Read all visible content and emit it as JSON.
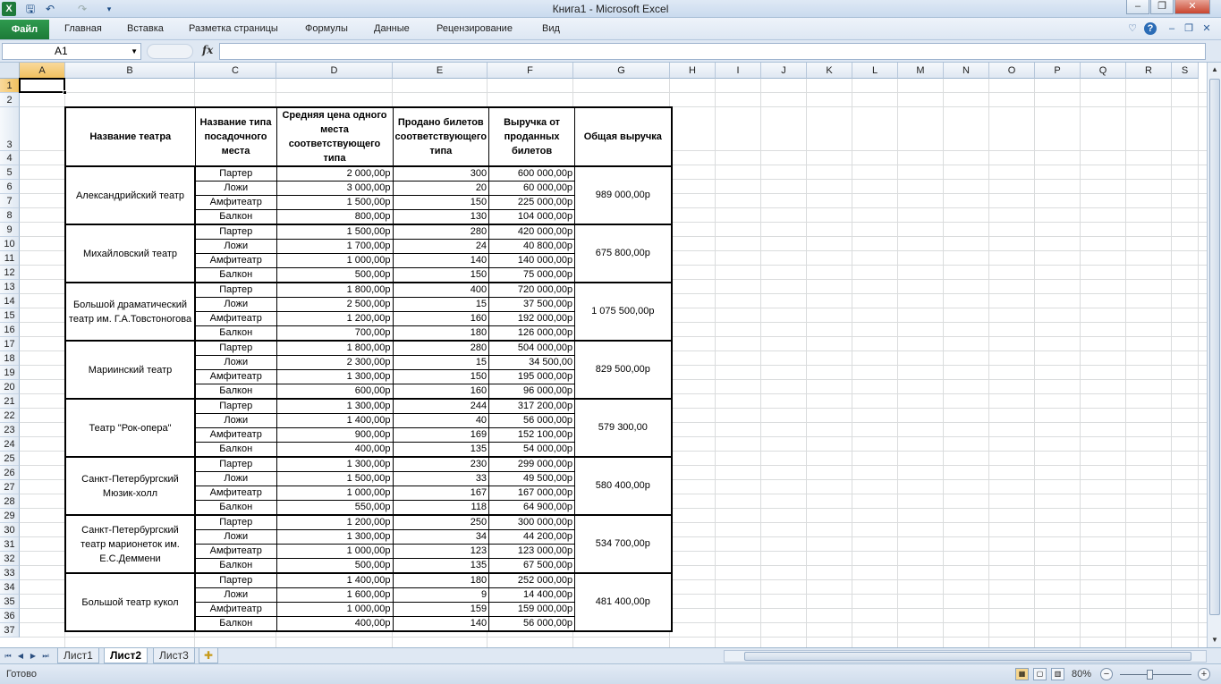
{
  "window": {
    "title": "Книга1 - Microsoft Excel",
    "app_icon": "excel-logo",
    "minimize": "–",
    "restore": "❐",
    "close": "✕"
  },
  "ribbon": {
    "file": "Файл",
    "tabs": [
      "Главная",
      "Вставка",
      "Разметка страницы",
      "Формулы",
      "Данные",
      "Рецензирование",
      "Вид"
    ]
  },
  "formula_bar": {
    "name_box": "A1",
    "fx": "fx",
    "formula": ""
  },
  "grid": {
    "columns": [
      "A",
      "B",
      "C",
      "D",
      "E",
      "F",
      "G",
      "H",
      "I",
      "J",
      "K",
      "L",
      "M",
      "N",
      "O",
      "P",
      "Q",
      "R",
      "S"
    ],
    "rows": [
      "1",
      "2",
      "3",
      "4",
      "5",
      "6",
      "7",
      "8",
      "9",
      "10",
      "11",
      "12",
      "13",
      "14",
      "15",
      "16",
      "17",
      "18",
      "19",
      "20",
      "21",
      "22",
      "23",
      "24",
      "25",
      "26",
      "27",
      "28",
      "29",
      "30",
      "31",
      "32",
      "33",
      "34",
      "35",
      "36",
      "37"
    ],
    "active_cell": "A1"
  },
  "table": {
    "headers": [
      "Название театра",
      "Название типа посадочного места",
      "Средняя цена одного места соответствующего типа",
      "Продано билетов соответствующего типа",
      "Выручка от проданных билетов",
      "Общая выручка"
    ],
    "groups": [
      {
        "theatre": "Александрийский театр",
        "total": "989 000,00р",
        "rows": [
          [
            "Партер",
            "2 000,00р",
            "300",
            "600 000,00р"
          ],
          [
            "Ложи",
            "3 000,00р",
            "20",
            "60 000,00р"
          ],
          [
            "Амфитеатр",
            "1 500,00р",
            "150",
            "225 000,00р"
          ],
          [
            "Балкон",
            "800,00р",
            "130",
            "104 000,00р"
          ]
        ]
      },
      {
        "theatre": "Михайловский театр",
        "total": "675 800,00р",
        "rows": [
          [
            "Партер",
            "1 500,00р",
            "280",
            "420 000,00р"
          ],
          [
            "Ложи",
            "1 700,00р",
            "24",
            "40 800,00р"
          ],
          [
            "Амфитеатр",
            "1 000,00р",
            "140",
            "140 000,00р"
          ],
          [
            "Балкон",
            "500,00р",
            "150",
            "75 000,00р"
          ]
        ]
      },
      {
        "theatre": "Большой драматический театр им. Г.А.Товстоногова",
        "total": "1 075 500,00р",
        "rows": [
          [
            "Партер",
            "1 800,00р",
            "400",
            "720 000,00р"
          ],
          [
            "Ложи",
            "2 500,00р",
            "15",
            "37 500,00р"
          ],
          [
            "Амфитеатр",
            "1 200,00р",
            "160",
            "192 000,00р"
          ],
          [
            "Балкон",
            "700,00р",
            "180",
            "126 000,00р"
          ]
        ]
      },
      {
        "theatre": "Мариинский театр",
        "total": "829 500,00р",
        "rows": [
          [
            "Партер",
            "1 800,00р",
            "280",
            "504 000,00р"
          ],
          [
            "Ложи",
            "2 300,00р",
            "15",
            "34 500,00"
          ],
          [
            "Амфитеатр",
            "1 300,00р",
            "150",
            "195 000,00р"
          ],
          [
            "Балкон",
            "600,00р",
            "160",
            "96 000,00р"
          ]
        ]
      },
      {
        "theatre": "Театр \"Рок-опера\"",
        "total": "579 300,00",
        "rows": [
          [
            "Партер",
            "1 300,00р",
            "244",
            "317 200,00р"
          ],
          [
            "Ложи",
            "1 400,00р",
            "40",
            "56 000,00р"
          ],
          [
            "Амфитеатр",
            "900,00р",
            "169",
            "152 100,00р"
          ],
          [
            "Балкон",
            "400,00р",
            "135",
            "54 000,00р"
          ]
        ]
      },
      {
        "theatre": "Санкт-Петербургский Мюзик-холл",
        "total": "580 400,00р",
        "rows": [
          [
            "Партер",
            "1 300,00р",
            "230",
            "299 000,00р"
          ],
          [
            "Ложи",
            "1 500,00р",
            "33",
            "49 500,00р"
          ],
          [
            "Амфитеатр",
            "1 000,00р",
            "167",
            "167 000,00р"
          ],
          [
            "Балкон",
            "550,00р",
            "118",
            "64 900,00р"
          ]
        ]
      },
      {
        "theatre": "Санкт-Петербургский театр марионеток им. Е.С.Деммени",
        "total": "534 700,00р",
        "rows": [
          [
            "Партер",
            "1 200,00р",
            "250",
            "300 000,00р"
          ],
          [
            "Ложи",
            "1 300,00р",
            "34",
            "44 200,00р"
          ],
          [
            "Амфитеатр",
            "1 000,00р",
            "123",
            "123 000,00р"
          ],
          [
            "Балкон",
            "500,00р",
            "135",
            "67 500,00р"
          ]
        ]
      },
      {
        "theatre": "Большой театр кукол",
        "total": "481 400,00р",
        "rows": [
          [
            "Партер",
            "1 400,00р",
            "180",
            "252 000,00р"
          ],
          [
            "Ложи",
            "1 600,00р",
            "9",
            "14 400,00р"
          ],
          [
            "Амфитеатр",
            "1 000,00р",
            "159",
            "159 000,00р"
          ],
          [
            "Балкон",
            "400,00р",
            "140",
            "56 000,00р"
          ]
        ]
      }
    ]
  },
  "sheets": [
    "Лист1",
    "Лист2",
    "Лист3"
  ],
  "active_sheet": "Лист2",
  "status": {
    "ready": "Готово",
    "zoom": "80%"
  },
  "colors": {
    "file_tab": "#1c7a37",
    "active_header": "#f1c15f",
    "grid_line": "#dadcdd"
  }
}
